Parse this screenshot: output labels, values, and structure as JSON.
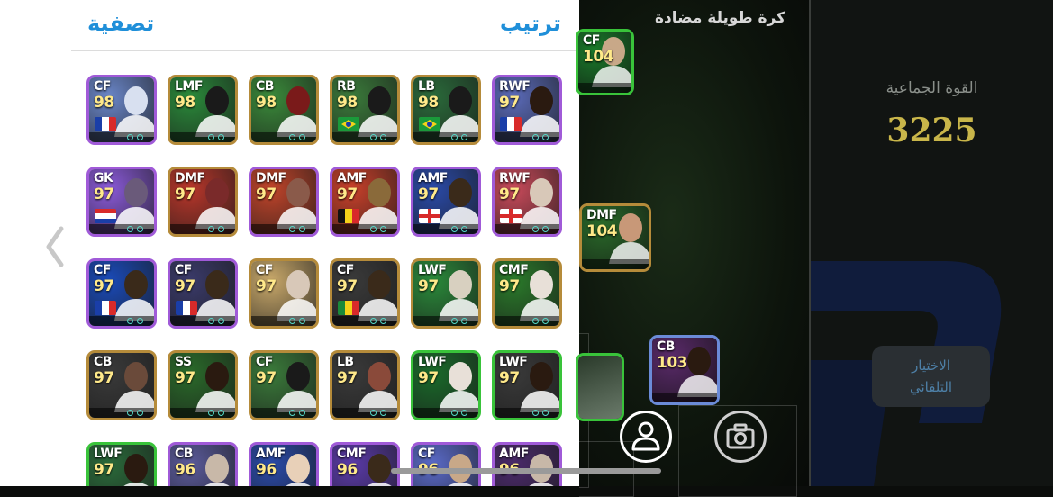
{
  "header": {
    "filter_label": "تصفية",
    "sort_label": "ترتيب"
  },
  "pitch": {
    "formation_title": "كرة طويلة مضادة",
    "cards": [
      {
        "pos": "CF",
        "rating": "104"
      },
      {
        "pos": "DMF",
        "rating": "104"
      },
      {
        "pos": "CB",
        "rating": "103"
      }
    ]
  },
  "team": {
    "label": "القوة الجماعية",
    "value": "3225"
  },
  "auto_select": {
    "line1": "الاختيار",
    "line2": "التلقائي"
  },
  "icons": {
    "back": "chevron-left-icon",
    "profile": "person-icon",
    "camera": "camera-icon"
  },
  "colors": {
    "accent": "#1f8fd9",
    "rating": "#ffe98a",
    "team_value": "#c9b64a"
  },
  "players": [
    {
      "pos": "CF",
      "rating": "98"
    },
    {
      "pos": "LMF",
      "rating": "98"
    },
    {
      "pos": "CB",
      "rating": "98"
    },
    {
      "pos": "RB",
      "rating": "98"
    },
    {
      "pos": "LB",
      "rating": "98"
    },
    {
      "pos": "RWF",
      "rating": "97"
    },
    {
      "pos": "GK",
      "rating": "97"
    },
    {
      "pos": "DMF",
      "rating": "97"
    },
    {
      "pos": "DMF",
      "rating": "97"
    },
    {
      "pos": "AMF",
      "rating": "97"
    },
    {
      "pos": "AMF",
      "rating": "97"
    },
    {
      "pos": "RWF",
      "rating": "97"
    },
    {
      "pos": "CF",
      "rating": "97"
    },
    {
      "pos": "CF",
      "rating": "97"
    },
    {
      "pos": "CF",
      "rating": "97"
    },
    {
      "pos": "CF",
      "rating": "97"
    },
    {
      "pos": "LWF",
      "rating": "97"
    },
    {
      "pos": "CMF",
      "rating": "97"
    },
    {
      "pos": "CB",
      "rating": "97"
    },
    {
      "pos": "SS",
      "rating": "97"
    },
    {
      "pos": "CF",
      "rating": "97"
    },
    {
      "pos": "LB",
      "rating": "97"
    },
    {
      "pos": "LWF",
      "rating": "97"
    },
    {
      "pos": "LWF",
      "rating": "97"
    },
    {
      "pos": "LWF",
      "rating": "97"
    },
    {
      "pos": "CB",
      "rating": "96"
    },
    {
      "pos": "AMF",
      "rating": "96"
    },
    {
      "pos": "CMF",
      "rating": "96"
    },
    {
      "pos": "CF",
      "rating": "96"
    },
    {
      "pos": "AMF",
      "rating": "96"
    }
  ]
}
